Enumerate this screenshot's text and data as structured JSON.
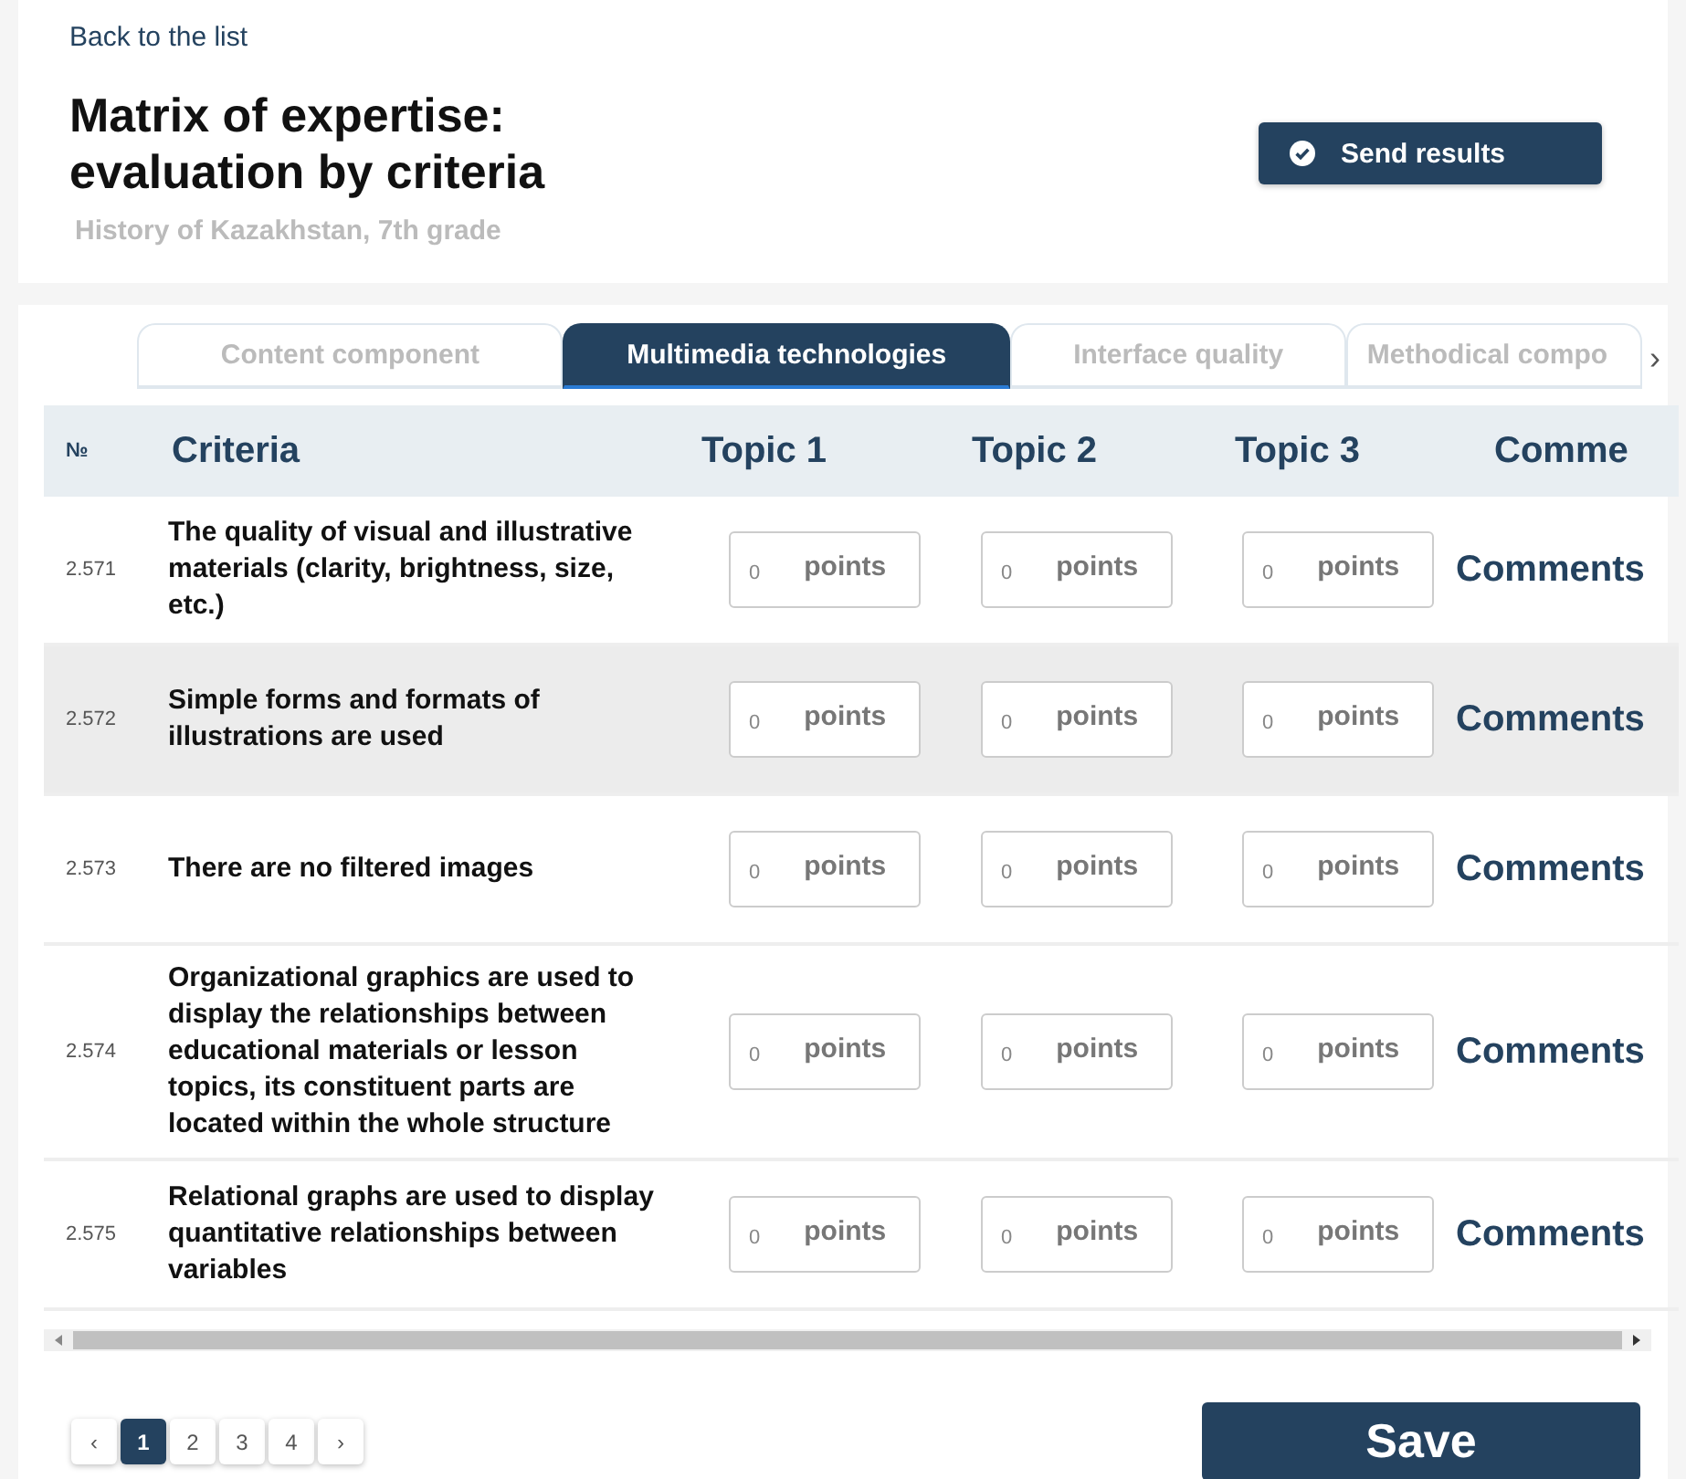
{
  "back_link": "Back to the list",
  "title": "Matrix of expertise: evaluation by criteria",
  "subtitle": "History of Kazakhstan, 7th grade",
  "send_button": "Send results",
  "tabs": [
    {
      "label": "Content component",
      "selected": false
    },
    {
      "label": "Multimedia technologies",
      "selected": true
    },
    {
      "label": "Interface quality",
      "selected": false
    },
    {
      "label": "Methodical compo",
      "selected": false
    }
  ],
  "tabs_next": "›",
  "table": {
    "columns": [
      "№",
      "Criteria",
      "Topic 1",
      "Topic 2",
      "Topic 3",
      "Comme"
    ],
    "rows": [
      {
        "number": "2.571",
        "criterion": "The quality of visual and illustrative materials (clarity, brightness, size, etc.)",
        "scores": [
          {
            "value": "0",
            "unit": "points"
          },
          {
            "value": "0",
            "unit": "points"
          },
          {
            "value": "0",
            "unit": "points"
          }
        ],
        "comments": "Comments",
        "highlighted": false
      },
      {
        "number": "2.572",
        "criterion": "Simple forms and formats of illustrations are used",
        "scores": [
          {
            "value": "0",
            "unit": "points"
          },
          {
            "value": "0",
            "unit": "points"
          },
          {
            "value": "0",
            "unit": "points"
          }
        ],
        "comments": "Comments",
        "highlighted": true
      },
      {
        "number": "2.573",
        "criterion": "There are no filtered images",
        "scores": [
          {
            "value": "0",
            "unit": "points"
          },
          {
            "value": "0",
            "unit": "points"
          },
          {
            "value": "0",
            "unit": "points"
          }
        ],
        "comments": "Comments",
        "highlighted": false
      },
      {
        "number": "2.574",
        "criterion": "Organizational graphics are used to display the relationships between educational materials or lesson topics, its constituent parts are located within the whole structure",
        "scores": [
          {
            "value": "0",
            "unit": "points"
          },
          {
            "value": "0",
            "unit": "points"
          },
          {
            "value": "0",
            "unit": "points"
          }
        ],
        "comments": "Comments",
        "highlighted": false
      },
      {
        "number": "2.575",
        "criterion": "Relational graphs are used to display quantitative relationships between variables",
        "scores": [
          {
            "value": "0",
            "unit": "points"
          },
          {
            "value": "0",
            "unit": "points"
          },
          {
            "value": "0",
            "unit": "points"
          }
        ],
        "comments": "Comments",
        "highlighted": false
      }
    ]
  },
  "pagination": {
    "prev": "‹",
    "next": "›",
    "pages": [
      {
        "label": "1",
        "selected": true
      },
      {
        "label": "2",
        "selected": false
      },
      {
        "label": "3",
        "selected": false
      },
      {
        "label": "4",
        "selected": false
      }
    ]
  },
  "save_button": "Save"
}
